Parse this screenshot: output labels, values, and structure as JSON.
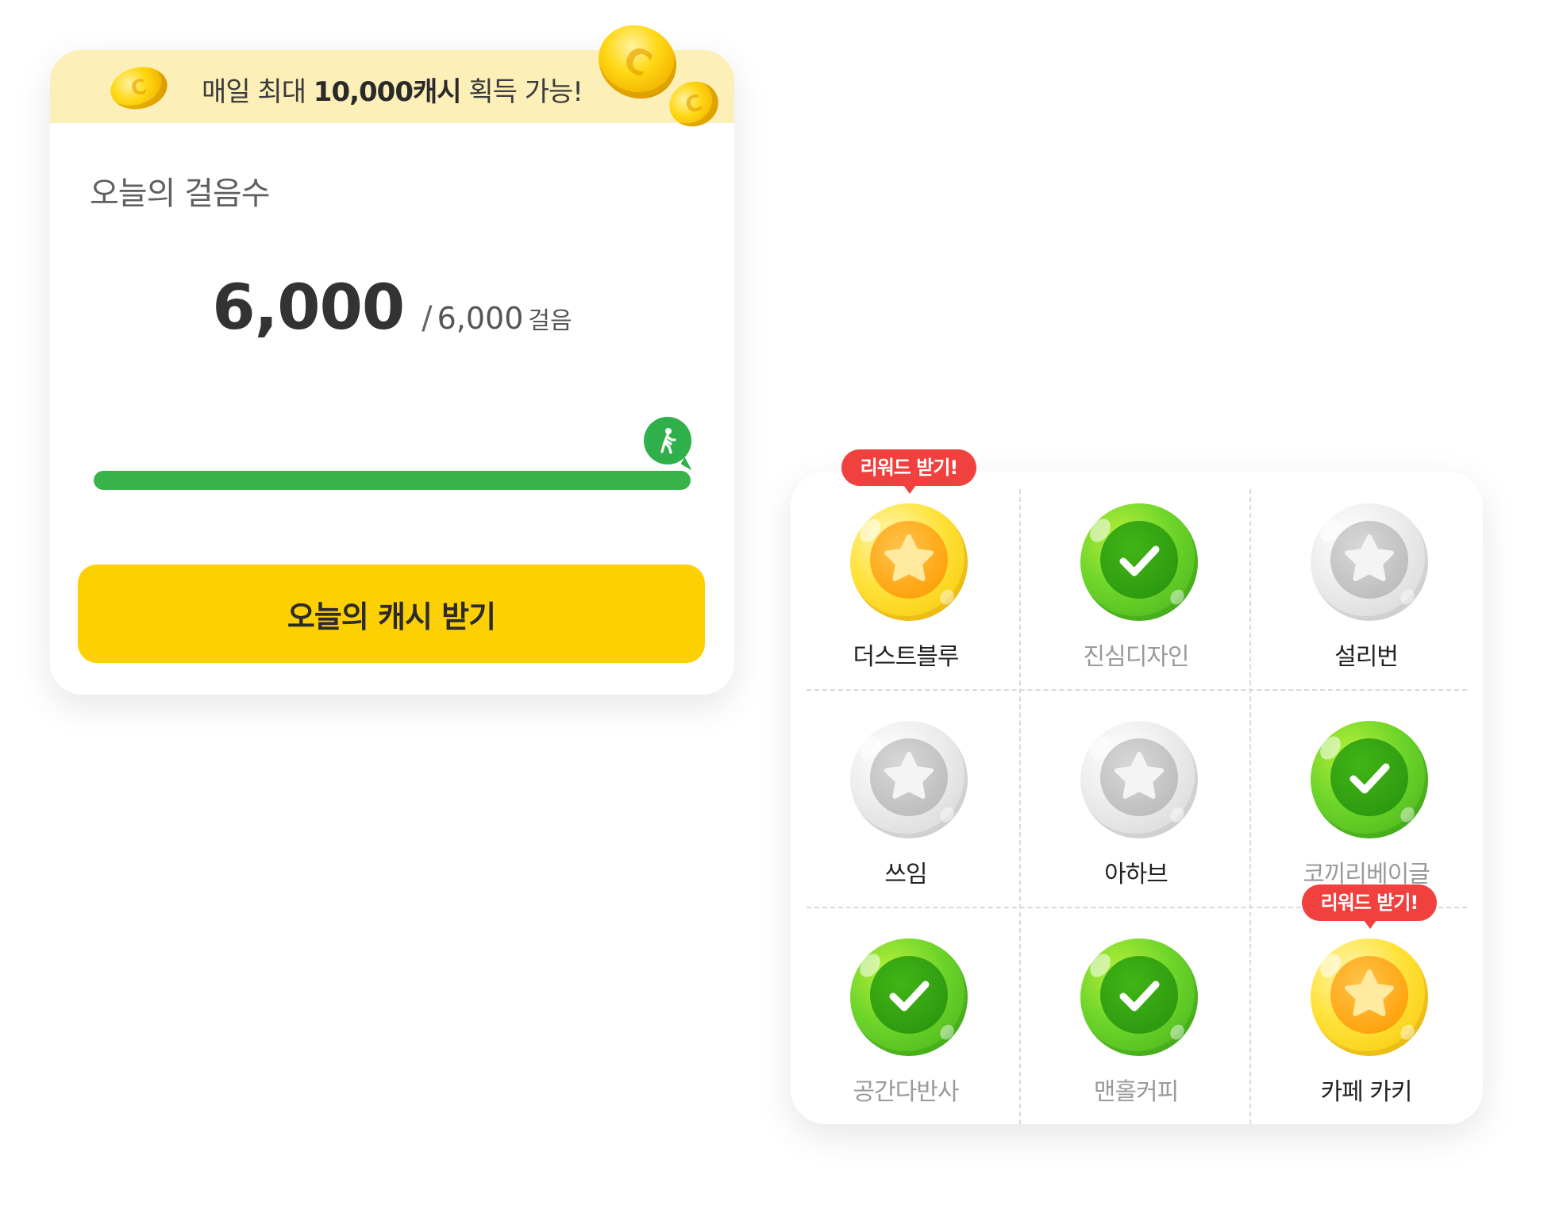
{
  "step_card": {
    "banner": {
      "prefix": "매일 최대 ",
      "highlight": "10,000캐시",
      "suffix": " 획득 가능!"
    },
    "title": "오늘의 걸음수",
    "current_steps": "6,000",
    "separator": "/",
    "goal_steps": "6,000",
    "unit": "걸음",
    "progress": 1.0,
    "button_label": "오늘의 캐시 받기",
    "colors": {
      "banner_bg": "#fdefb8",
      "progress": "#38b34a",
      "button": "#fdd003"
    }
  },
  "stamp_card": {
    "reward_label": "리워드 받기!",
    "stores": [
      {
        "name": "더스트블루",
        "state": "reward",
        "icon": "gold-star-badge-icon"
      },
      {
        "name": "진심디자인",
        "state": "done",
        "icon": "green-check-badge-icon"
      },
      {
        "name": "설리번",
        "state": "locked",
        "icon": "gray-star-badge-icon"
      },
      {
        "name": "쓰임",
        "state": "locked",
        "icon": "gray-star-badge-icon"
      },
      {
        "name": "아하브",
        "state": "locked",
        "icon": "gray-star-badge-icon"
      },
      {
        "name": "코끼리베이글",
        "state": "done",
        "icon": "green-check-badge-icon"
      },
      {
        "name": "공간다반사",
        "state": "done",
        "icon": "green-check-badge-icon"
      },
      {
        "name": "맨홀커피",
        "state": "done",
        "icon": "green-check-badge-icon"
      },
      {
        "name": "카페 카키",
        "state": "reward",
        "icon": "gold-star-badge-icon"
      }
    ],
    "colors": {
      "reward_tip": "#f0413f",
      "done_green": "#41b516",
      "gold": "#ffa715",
      "locked_gray": "#c3c3c3"
    }
  }
}
